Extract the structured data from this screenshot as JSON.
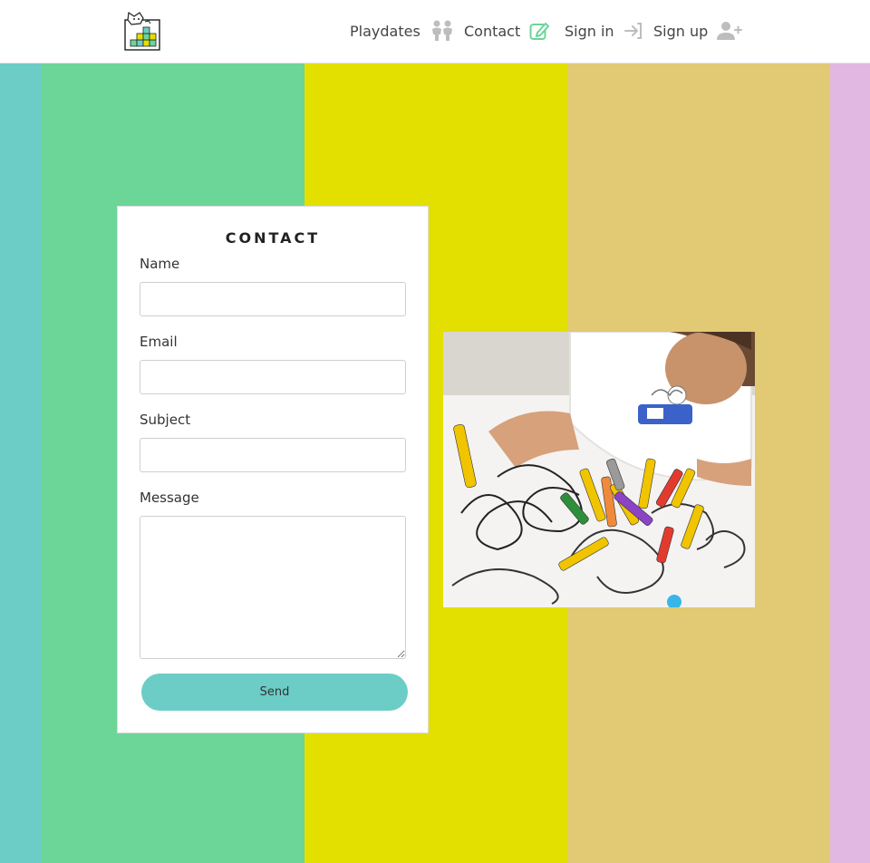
{
  "colors": {
    "stripe_teal": "#6ccdc6",
    "stripe_green": "#6cd598",
    "stripe_yellow": "#e3e000",
    "stripe_tan": "#e2c974",
    "stripe_lilac": "#e1b8e1",
    "send_button": "#6ccdc6",
    "nav_icon": "#bdbdbd",
    "contact_icon": "#6cd598"
  },
  "header": {
    "logo_icon": "toy-blocks-logo-icon",
    "nav": {
      "playdates": {
        "label": "Playdates",
        "icon": "children-icon"
      },
      "contact": {
        "label": "Contact",
        "icon": "edit-icon"
      },
      "sign_in": {
        "label": "Sign in",
        "icon": "sign-in-icon"
      },
      "sign_up": {
        "label": "Sign up",
        "icon": "user-plus-icon"
      }
    }
  },
  "contact_form": {
    "title": "CONTACT",
    "name_label": "Name",
    "name_value": "",
    "email_label": "Email",
    "email_value": "",
    "subject_label": "Subject",
    "subject_value": "",
    "message_label": "Message",
    "message_value": "",
    "send_label": "Send"
  },
  "photo": {
    "subject": "child-drawing-with-crayons-image"
  }
}
